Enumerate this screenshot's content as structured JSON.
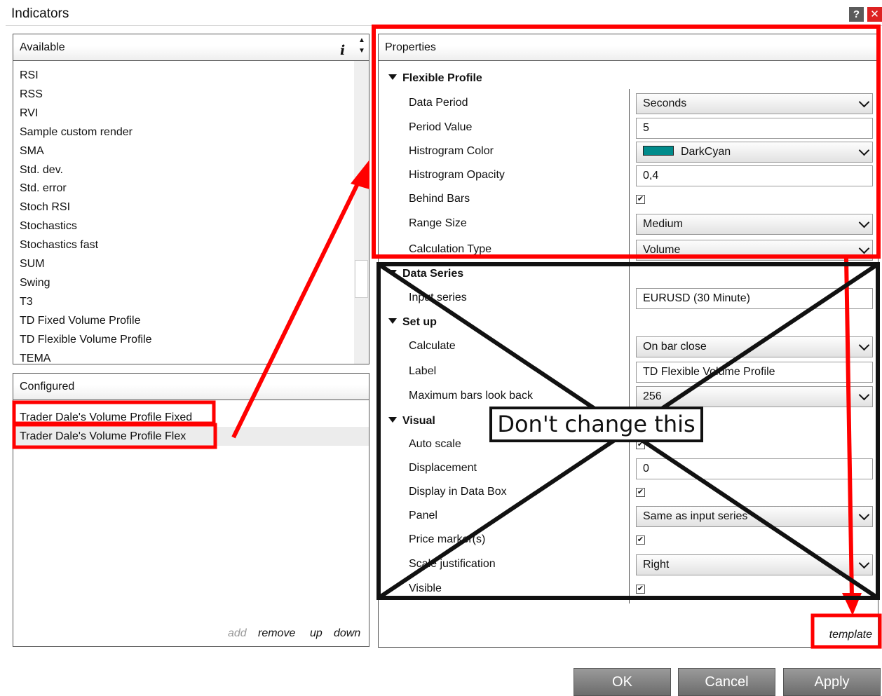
{
  "window": {
    "title": "Indicators",
    "help_label": "?",
    "close_label": "✕"
  },
  "available": {
    "header": "Available",
    "items": [
      "RSI",
      "RSS",
      "RVI",
      "Sample custom render",
      "SMA",
      "Std. dev.",
      "Std. error",
      "Stoch RSI",
      "Stochastics",
      "Stochastics fast",
      "SUM",
      "Swing",
      "T3",
      "TD Fixed Volume Profile",
      "TD Flexible Volume Profile",
      "TEMA"
    ]
  },
  "configured": {
    "header": "Configured",
    "items": [
      "Trader Dale's Volume Profile Fixed",
      "Trader Dale's Volume Profile Flex"
    ],
    "actions": {
      "add": "add",
      "remove": "remove",
      "up": "up",
      "down": "down"
    }
  },
  "properties": {
    "header": "Properties",
    "sections": {
      "flexible_profile": "Flexible Profile",
      "data_series": "Data Series",
      "set_up": "Set up",
      "visual": "Visual"
    },
    "labels": {
      "data_period": "Data Period",
      "period_value": "Period Value",
      "histogram_color": "Histrogram Color",
      "histogram_opacity": "Histrogram Opacity",
      "behind_bars": "Behind Bars",
      "range_size": "Range Size",
      "calculation_type": "Calculation Type",
      "input_series": "Input series",
      "calculate": "Calculate",
      "label": "Label",
      "max_bars": "Maximum bars look back",
      "auto_scale": "Auto scale",
      "displacement": "Displacement",
      "display_data_box": "Display in Data Box",
      "panel": "Panel",
      "price_markers": "Price marker(s)",
      "scale_justification": "Scale justification",
      "visible": "Visible"
    },
    "values": {
      "data_period": "Seconds",
      "period_value": "5",
      "histogram_color": "DarkCyan",
      "histogram_opacity": "0,4",
      "range_size": "Medium",
      "calculation_type": "Volume",
      "input_series": "EURUSD (30 Minute)",
      "calculate": "On bar close",
      "label": "TD Flexible Volume Profile",
      "max_bars": "256",
      "displacement": "0",
      "panel": "Same as input series",
      "scale_justification": "Right"
    },
    "checks": {
      "checked_glyph": "✔"
    },
    "template_link": "template"
  },
  "buttons": {
    "ok": "OK",
    "cancel": "Cancel",
    "apply": "Apply"
  },
  "annotation": {
    "text": "Don't change this"
  },
  "colors": {
    "highlight": "#ff0000",
    "cross": "#111111",
    "swatch": "#008b8b"
  }
}
